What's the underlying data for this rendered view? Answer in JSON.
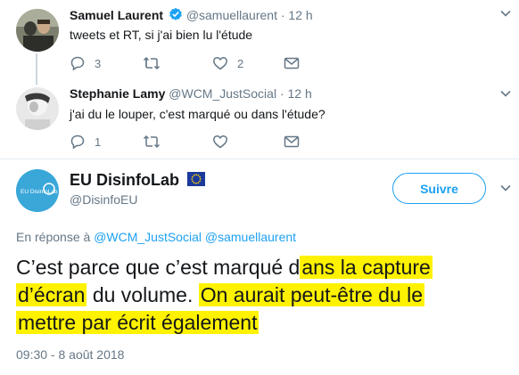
{
  "tweets": [
    {
      "name": "Samuel Laurent",
      "verified": true,
      "handle": "@samuellaurent",
      "separator": "·",
      "time": "12 h",
      "text": "tweets et RT, si j'ai bien lu l'étude",
      "replies": "3",
      "retweets": "",
      "likes": "2"
    },
    {
      "name": "Stephanie Lamy",
      "handle": "@WCM_JustSocial",
      "separator": "·",
      "time": "12 h",
      "text": "j'ai du le louper, c'est marqué ou dans l'étude?",
      "replies": "1",
      "retweets": "",
      "likes": ""
    }
  ],
  "main": {
    "name": "EU DisinfoLab",
    "handle": "@DisinfoEU",
    "follow_label": "Suivre",
    "avatar_text": "EU DisinfoLab",
    "reply_prefix": "En réponse à",
    "reply_to_1": "@WCM_JustSocial",
    "reply_to_2": "@samuellaurent",
    "text_line1_a": "C’est parce que c’est marqué d",
    "text_line1_b": "ans la capture",
    "text_line2_a": "d’écran",
    "text_line2_b": " du volume. ",
    "text_line2_c": "On aurait peut-être du le",
    "text_line3": "mettre par écrit également",
    "timestamp": "09:30 - 8 août 2018"
  },
  "colors": {
    "accent": "#1da1f2",
    "highlight": "#fff200",
    "muted": "#657786"
  },
  "icons": [
    "reply-icon",
    "retweet-icon",
    "like-icon",
    "message-icon",
    "chevron-down-icon",
    "verified-badge-icon",
    "eu-flag-icon"
  ]
}
